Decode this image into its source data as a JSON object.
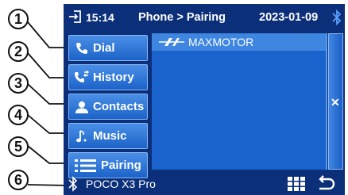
{
  "callouts": [
    "1",
    "2",
    "3",
    "4",
    "5",
    "6"
  ],
  "header": {
    "time": "15:14",
    "title": "Phone > Pairing",
    "date": "2023-01-09",
    "icons": [
      "exit-icon",
      "bluetooth-icon"
    ]
  },
  "menu": {
    "items": [
      {
        "label": "Dial",
        "icon": "phone-icon"
      },
      {
        "label": "History",
        "icon": "call-history-icon"
      },
      {
        "label": "Contacts",
        "icon": "contact-person-icon"
      },
      {
        "label": "Music",
        "icon": "music-note-icon"
      },
      {
        "label": "Pairing",
        "icon": "list-icon"
      }
    ]
  },
  "devices": [
    {
      "name": "MAXMOTOR",
      "icon": "maxmotor-logo-icon",
      "selected": true
    }
  ],
  "side_panel": {
    "icon": "close-icon",
    "glyph": "✕"
  },
  "footer": {
    "connected_device": "POCO  X3 Pro",
    "icons": [
      "bluetooth-icon",
      "grid-icon",
      "back-icon"
    ]
  },
  "colors": {
    "screen_bg": "#0c2f7a",
    "button_top": "#4a8fe6",
    "button_bottom": "#1c63c9",
    "list_bg": "#1a62cc",
    "selected_row": "#3e86e0",
    "bluetooth": "#5aa0ff"
  }
}
